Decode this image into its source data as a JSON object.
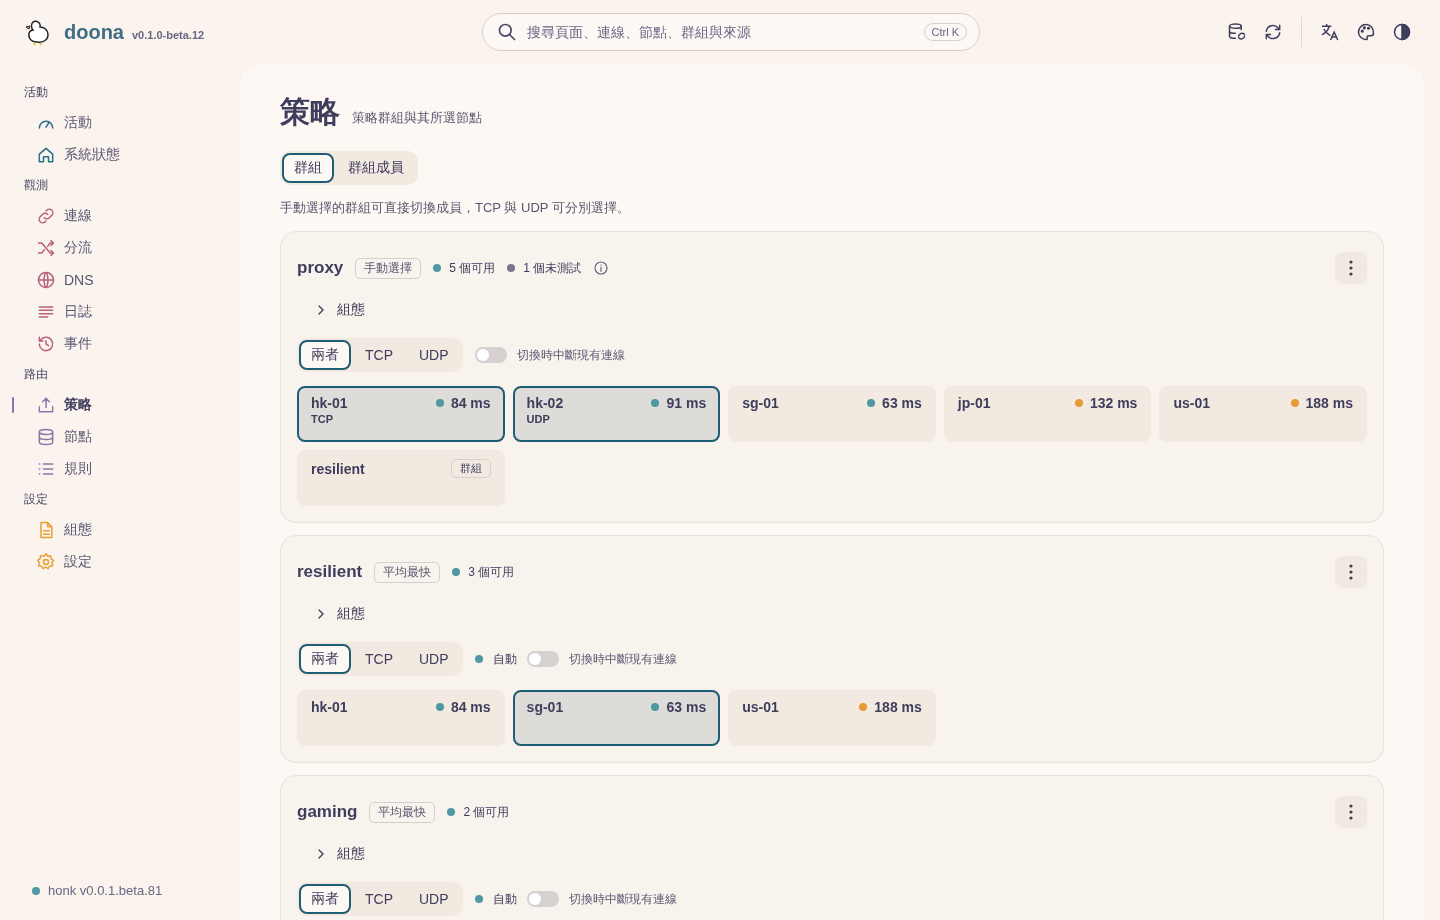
{
  "brand": {
    "name": "doona",
    "version": "v0.1.0-beta.12"
  },
  "search": {
    "placeholder": "搜尋頁面、連線、節點、群組與來源",
    "shortcut": "Ctrl K"
  },
  "sidebar": {
    "sections": [
      {
        "title": "活動",
        "color": "#2c6e85",
        "items": [
          {
            "label": "活動",
            "selected": false
          },
          {
            "label": "系統狀態",
            "selected": false
          }
        ]
      },
      {
        "title": "觀測",
        "color": "#b8607a",
        "items": [
          {
            "label": "連線",
            "selected": false
          },
          {
            "label": "分流",
            "selected": false
          },
          {
            "label": "DNS",
            "selected": false
          },
          {
            "label": "日誌",
            "selected": false
          },
          {
            "label": "事件",
            "selected": false
          }
        ]
      },
      {
        "title": "路由",
        "color": "#8a78a8",
        "items": [
          {
            "label": "策略",
            "selected": true
          },
          {
            "label": "節點",
            "selected": false
          },
          {
            "label": "規則",
            "selected": false
          }
        ]
      },
      {
        "title": "設定",
        "color": "#e8a030",
        "items": [
          {
            "label": "組態",
            "selected": false
          },
          {
            "label": "設定",
            "selected": false
          }
        ]
      }
    ],
    "footer": "honk v0.0.1.beta.81"
  },
  "page": {
    "title": "策略",
    "subtitle": "策略群組與其所選節點",
    "tabs": [
      {
        "label": "群組",
        "selected": true
      },
      {
        "label": "群組成員",
        "selected": false
      }
    ],
    "hint": "手動選擇的群組可直接切換成員，TCP 與 UDP 可分別選擇。"
  },
  "groups": [
    {
      "name": "proxy",
      "type": "手動選擇",
      "stats": [
        {
          "text": "5 個可用",
          "color": "#4f97a3"
        },
        {
          "text": "1 個未測試",
          "color": "#7a7490"
        }
      ],
      "info": true,
      "config_label": "組態",
      "expanded": false,
      "modes": [
        {
          "label": "兩者",
          "selected": true
        },
        {
          "label": "TCP",
          "selected": false
        },
        {
          "label": "UDP",
          "selected": false
        }
      ],
      "disconnect": {
        "label": "切換時中斷現有連線",
        "on": false
      },
      "nodes": [
        {
          "kind": "node",
          "name": "hk-01",
          "latency": "84 ms",
          "color": "#4f97a3",
          "protocol": "TCP",
          "selected": true
        },
        {
          "kind": "node",
          "name": "hk-02",
          "latency": "91 ms",
          "color": "#4f97a3",
          "protocol": "UDP",
          "selected": true
        },
        {
          "kind": "node",
          "name": "sg-01",
          "latency": "63 ms",
          "color": "#4f97a3",
          "selected": false
        },
        {
          "kind": "node",
          "name": "jp-01",
          "latency": "132 ms",
          "color": "#e89a35",
          "selected": false
        },
        {
          "kind": "node",
          "name": "us-01",
          "latency": "188 ms",
          "color": "#e89a35",
          "selected": false
        },
        {
          "kind": "group",
          "name": "resilient",
          "badge": "群組",
          "selected": false
        }
      ]
    },
    {
      "name": "resilient",
      "type": "平均最快",
      "stats": [
        {
          "text": "3 個可用",
          "color": "#4f97a3"
        }
      ],
      "info": false,
      "config_label": "組態",
      "expanded": false,
      "modes": [
        {
          "label": "兩者",
          "selected": true
        },
        {
          "label": "TCP",
          "selected": false
        },
        {
          "label": "UDP",
          "selected": false
        }
      ],
      "auto_label": "自動",
      "disconnect": {
        "label": "切換時中斷現有連線",
        "on": false
      },
      "nodes": [
        {
          "kind": "node",
          "name": "hk-01",
          "latency": "84 ms",
          "color": "#4f97a3",
          "selected": false
        },
        {
          "kind": "node",
          "name": "sg-01",
          "latency": "63 ms",
          "color": "#4f97a3",
          "selected": true
        },
        {
          "kind": "node",
          "name": "us-01",
          "latency": "188 ms",
          "color": "#e89a35",
          "selected": false
        }
      ]
    },
    {
      "name": "gaming",
      "type": "平均最快",
      "stats": [
        {
          "text": "2 個可用",
          "color": "#4f97a3"
        }
      ],
      "info": false,
      "config_label": "組態",
      "expanded": false,
      "modes": [
        {
          "label": "兩者",
          "selected": true
        },
        {
          "label": "TCP",
          "selected": false
        },
        {
          "label": "UDP",
          "selected": false
        }
      ],
      "auto_label": "自動",
      "disconnect": {
        "label": "切換時中斷現有連線",
        "on": false
      }
    }
  ]
}
